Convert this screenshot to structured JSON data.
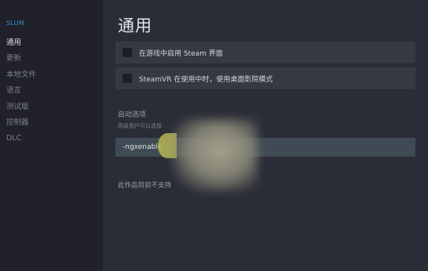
{
  "sidebar": {
    "title": "SLUM",
    "items": [
      {
        "label": "通用",
        "active": true
      },
      {
        "label": "更新",
        "active": false
      },
      {
        "label": "本地文件",
        "active": false
      },
      {
        "label": "语言",
        "active": false
      },
      {
        "label": "测试版",
        "active": false
      },
      {
        "label": "控制器",
        "active": false
      },
      {
        "label": "DLC",
        "active": false
      }
    ]
  },
  "main": {
    "heading": "通用",
    "options": [
      {
        "label": "在游戏中启用 Steam 界面",
        "checked": false
      },
      {
        "label": "SteamVR 在使用中时，使用桌面影院模式",
        "checked": false
      }
    ],
    "launch": {
      "heading": "启动选项",
      "description": "高级用户可以选择",
      "value": "-ngxenable"
    },
    "note": "此作品目前不支持"
  },
  "colors": {
    "sidebar_bg": "#20212a",
    "main_bg": "#2a2c36",
    "accent": "#2f8ed1",
    "option_bg": "#363844",
    "input_bg": "#3f4a55"
  }
}
